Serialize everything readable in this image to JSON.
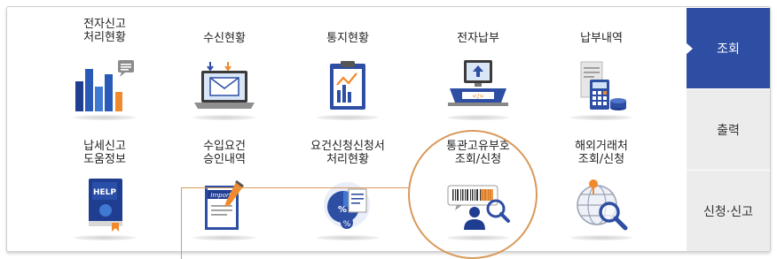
{
  "menu": {
    "row1": [
      {
        "label": "전자신고\n처리현황",
        "icon": "bar-chart-message-icon"
      },
      {
        "label": "수신현황",
        "icon": "laptop-mail-icon"
      },
      {
        "label": "통지현황",
        "icon": "clipboard-chart-icon"
      },
      {
        "label": "전자납부",
        "icon": "computer-payment-icon"
      },
      {
        "label": "납부내역",
        "icon": "receipt-calculator-coins-icon"
      }
    ],
    "row2": [
      {
        "label": "납세신고\n도움정보",
        "icon": "help-book-icon"
      },
      {
        "label": "수입요건\n승인내역",
        "icon": "import-document-pen-icon"
      },
      {
        "label": "요건신청신청서\n처리현황",
        "icon": "percent-document-icon"
      },
      {
        "label": "통관고유부호\n조회/신청",
        "icon": "barcode-person-search-icon"
      },
      {
        "label": "해외거래처\n조회/신청",
        "icon": "globe-search-icon"
      }
    ]
  },
  "side_tabs": [
    {
      "label": "조회",
      "active": true
    },
    {
      "label": "출력",
      "active": false
    },
    {
      "label": "신청·신고",
      "active": false
    }
  ],
  "icon_text": {
    "help": "HELP",
    "import": "Import",
    "percent": "%"
  },
  "colors": {
    "accent": "#2e4ea3",
    "callout": "#d9995a",
    "tab_inactive": "#ececec"
  }
}
